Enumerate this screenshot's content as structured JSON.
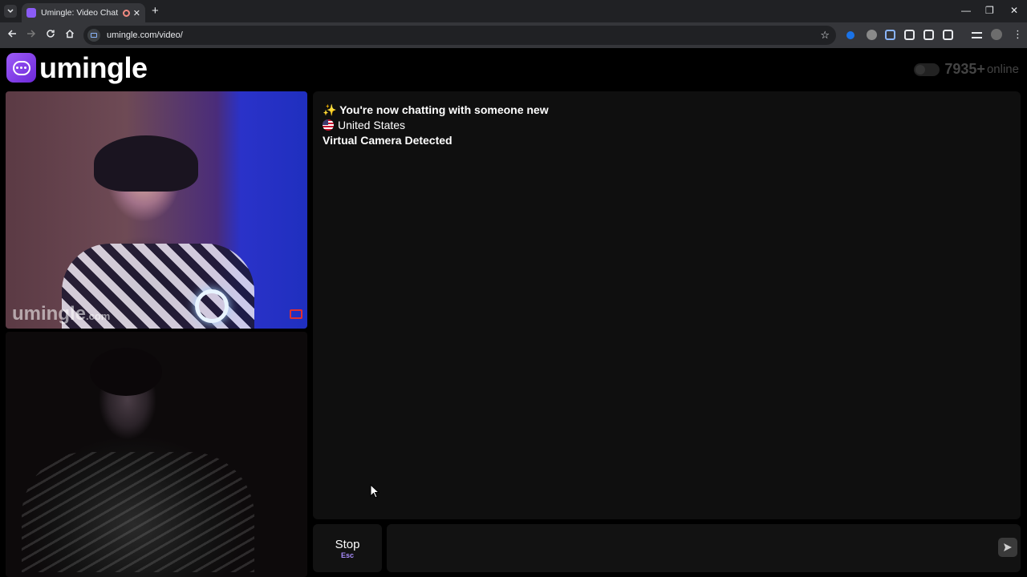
{
  "browser": {
    "tab_title": "Umingle: Video Chat with S",
    "url": "umingle.com/video/",
    "new_tab": "+",
    "tab_close": "✕",
    "win_minimize": "—",
    "win_restore": "❐",
    "win_close": "✕"
  },
  "site": {
    "logo_text": "umingle",
    "online_count": "7935+",
    "online_label": "online",
    "watermark_main": "umingle",
    "watermark_suffix": ".com"
  },
  "chat": {
    "messages": [
      {
        "emoji": "✨",
        "text": "You're now chatting with someone new"
      },
      {
        "text": "United States"
      },
      {
        "text": "Virtual Camera Detected"
      }
    ],
    "input_value": "",
    "stop_label": "Stop",
    "stop_key": "Esc"
  },
  "colors": {
    "brand": "#8b5cf6",
    "report": "#e03030",
    "key_hint": "#a78bfa"
  }
}
